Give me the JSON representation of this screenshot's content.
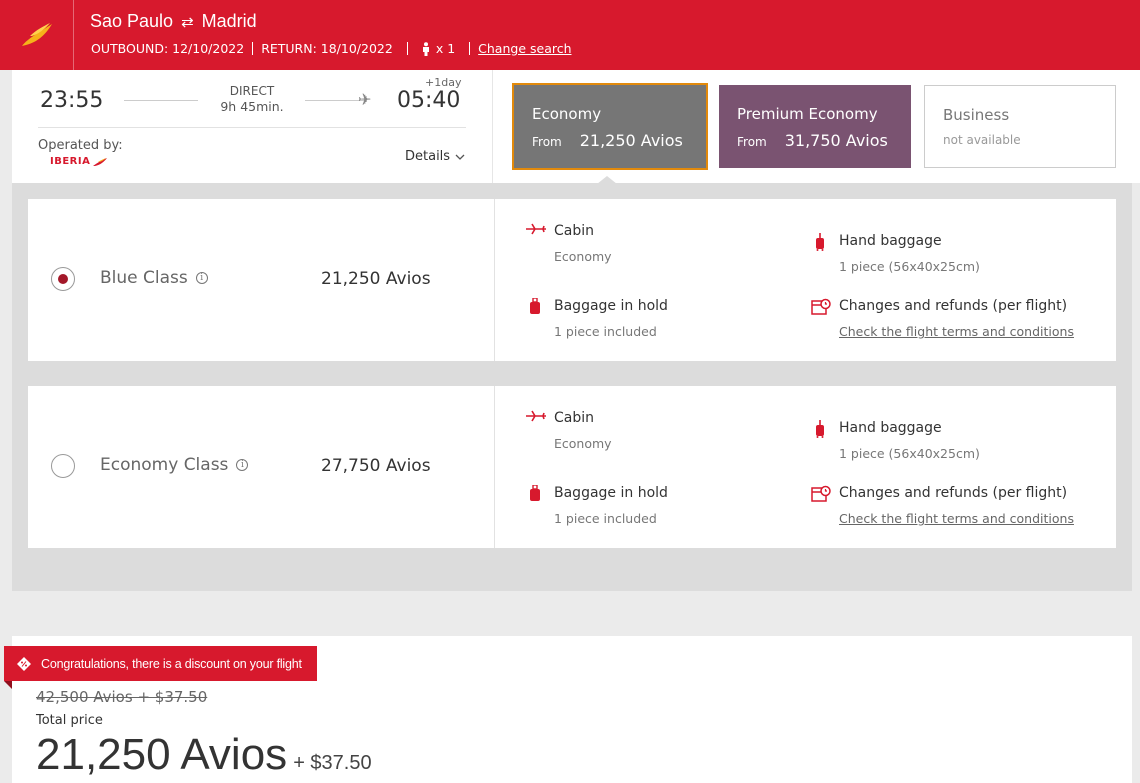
{
  "header": {
    "origin": "Sao Paulo",
    "destination": "Madrid",
    "swap_icon": "⇄",
    "outbound": "OUTBOUND: 12/10/2022",
    "return": "RETURN: 18/10/2022",
    "passengers": "x 1",
    "change_search": "Change search",
    "brand_color": "#d7192d"
  },
  "flight": {
    "departure_time": "23:55",
    "arrival_time": "05:40",
    "stops": "DIRECT",
    "duration": "9h 45min.",
    "plus_day": "+1day",
    "operated_by_label": "Operated by:",
    "carrier": "IBERIA",
    "details_label": "Details"
  },
  "cabin_tabs": [
    {
      "name": "Economy",
      "from_label": "From",
      "price": "21,250 Avios",
      "selected": true,
      "color": "#767676"
    },
    {
      "name": "Premium Economy",
      "from_label": "From",
      "price": "31,750 Avios",
      "selected": false,
      "color": "#7a5371"
    },
    {
      "name": "Business",
      "status": "not available",
      "selected": false
    }
  ],
  "fares": [
    {
      "name": "Blue Class",
      "price": "21,250 Avios",
      "selected": true,
      "cabin_title": "Cabin",
      "cabin_value": "Economy",
      "hold_title": "Baggage in hold",
      "hold_value": "1 piece included",
      "hand_title": "Hand baggage",
      "hand_value": "1 piece (56x40x25cm)",
      "changes_title": "Changes and refunds (per flight)",
      "changes_link": "Check the flight terms and conditions"
    },
    {
      "name": "Economy Class",
      "price": "27,750 Avios",
      "selected": false,
      "cabin_title": "Cabin",
      "cabin_value": "Economy",
      "hold_title": "Baggage in hold",
      "hold_value": "1 piece included",
      "hand_title": "Hand baggage",
      "hand_value": "1 piece (56x40x25cm)",
      "changes_title": "Changes and refunds (per flight)",
      "changes_link": "Check the flight terms and conditions"
    }
  ],
  "summary": {
    "discount_banner": "Congratulations, there is a discount on your flight",
    "old_price": "42,500 Avios + $37.50",
    "total_label": "Total price",
    "total_avios": "21,250 Avios",
    "total_extra": "+ $37.50"
  }
}
